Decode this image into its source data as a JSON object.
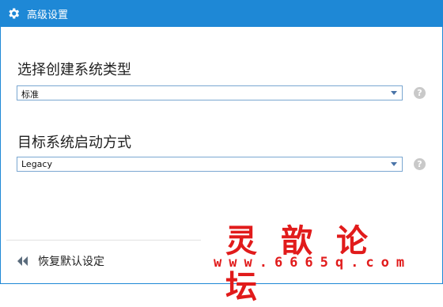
{
  "window": {
    "title": "高级设置",
    "accent": "#1e88d6"
  },
  "sections": [
    {
      "label": "选择创建系统类型",
      "value": "标准",
      "help": "?"
    },
    {
      "label": "目标系统启动方式",
      "value": "Legacy",
      "help": "?"
    }
  ],
  "footer": {
    "restore_label": "恢复默认设定"
  },
  "watermark": {
    "text": "灵歆论坛",
    "url": "www.6665q.com",
    "color": "#e11b1b"
  }
}
